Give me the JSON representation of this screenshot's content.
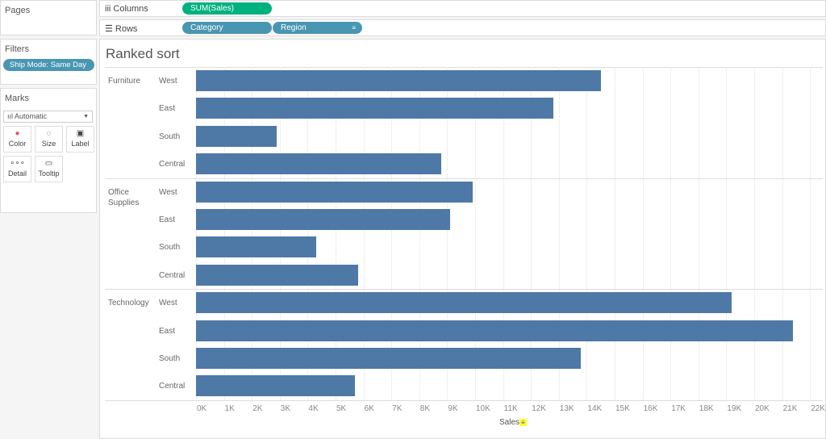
{
  "panels": {
    "pages": "Pages",
    "filters": "Filters",
    "marks": "Marks"
  },
  "filter_pill": "Ship Mode: Same Day",
  "marks": {
    "type": "Automatic",
    "buttons": [
      "Color",
      "Size",
      "Label",
      "Detail",
      "Tooltip"
    ]
  },
  "shelves": {
    "columns_label": "Columns",
    "rows_label": "Rows",
    "columns_pills": [
      "SUM(Sales)"
    ],
    "rows_pills": [
      "Category",
      "Region"
    ]
  },
  "colors": {
    "bar": "#4e79a7",
    "measure_pill": "#00b180",
    "dim_pill": "#4996b2"
  },
  "chart_data": {
    "type": "bar",
    "orientation": "horizontal",
    "title": "Ranked sort",
    "xlabel": "Sales",
    "ylabel": "",
    "xlim": [
      0,
      22000
    ],
    "tick_labels": [
      "0K",
      "1K",
      "2K",
      "3K",
      "4K",
      "5K",
      "6K",
      "7K",
      "8K",
      "9K",
      "10K",
      "11K",
      "12K",
      "13K",
      "14K",
      "15K",
      "16K",
      "17K",
      "18K",
      "19K",
      "20K",
      "21K",
      "22K"
    ],
    "groups": [
      {
        "category": "Furniture",
        "regions": [
          "West",
          "East",
          "South",
          "Central"
        ],
        "values": [
          14500,
          12800,
          2900,
          8800
        ]
      },
      {
        "category": "Office Supplies",
        "regions": [
          "West",
          "East",
          "South",
          "Central"
        ],
        "values": [
          9900,
          9100,
          4300,
          5800
        ]
      },
      {
        "category": "Technology",
        "regions": [
          "West",
          "East",
          "South",
          "Central"
        ],
        "values": [
          19200,
          21400,
          13800,
          5700
        ]
      }
    ]
  }
}
